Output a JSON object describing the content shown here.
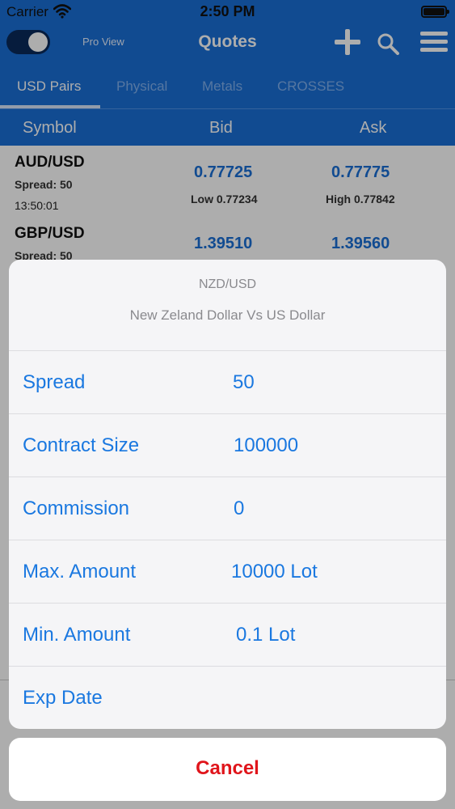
{
  "status_bar": {
    "carrier": "Carrier",
    "time": "2:50 PM"
  },
  "nav": {
    "pro_view_label": "Pro View",
    "title": "Quotes"
  },
  "tabs": [
    {
      "label": "USD Pairs",
      "active": true
    },
    {
      "label": "Physical",
      "active": false
    },
    {
      "label": "Metals",
      "active": false
    },
    {
      "label": "CROSSES",
      "active": false
    }
  ],
  "columns": {
    "symbol": "Symbol",
    "bid": "Bid",
    "ask": "Ask"
  },
  "quotes": [
    {
      "symbol": "AUD/USD",
      "spread": "Spread: 50",
      "time": "13:50:01",
      "bid": "0.77725",
      "ask": "0.77775",
      "low": "Low 0.77234",
      "high": "High 0.77842"
    },
    {
      "symbol": "GBP/USD",
      "spread": "Spread: 50",
      "bid": "1.39510",
      "ask": "1.39560"
    }
  ],
  "sheet": {
    "title": "NZD/USD",
    "subtitle": "New Zeland Dollar Vs US Dollar",
    "rows": [
      {
        "label": "Spread",
        "value": "50"
      },
      {
        "label": "Contract Size",
        "value": "100000"
      },
      {
        "label": "Commission",
        "value": "0"
      },
      {
        "label": "Max. Amount",
        "value": "10000 Lot"
      },
      {
        "label": "Min. Amount",
        "value": "0.1 Lot"
      },
      {
        "label": "Exp Date",
        "value": ""
      }
    ],
    "cancel_label": "Cancel"
  },
  "colors": {
    "primary": "#1a6fd6",
    "link": "#1a78e0",
    "cancel": "#e0151b"
  }
}
